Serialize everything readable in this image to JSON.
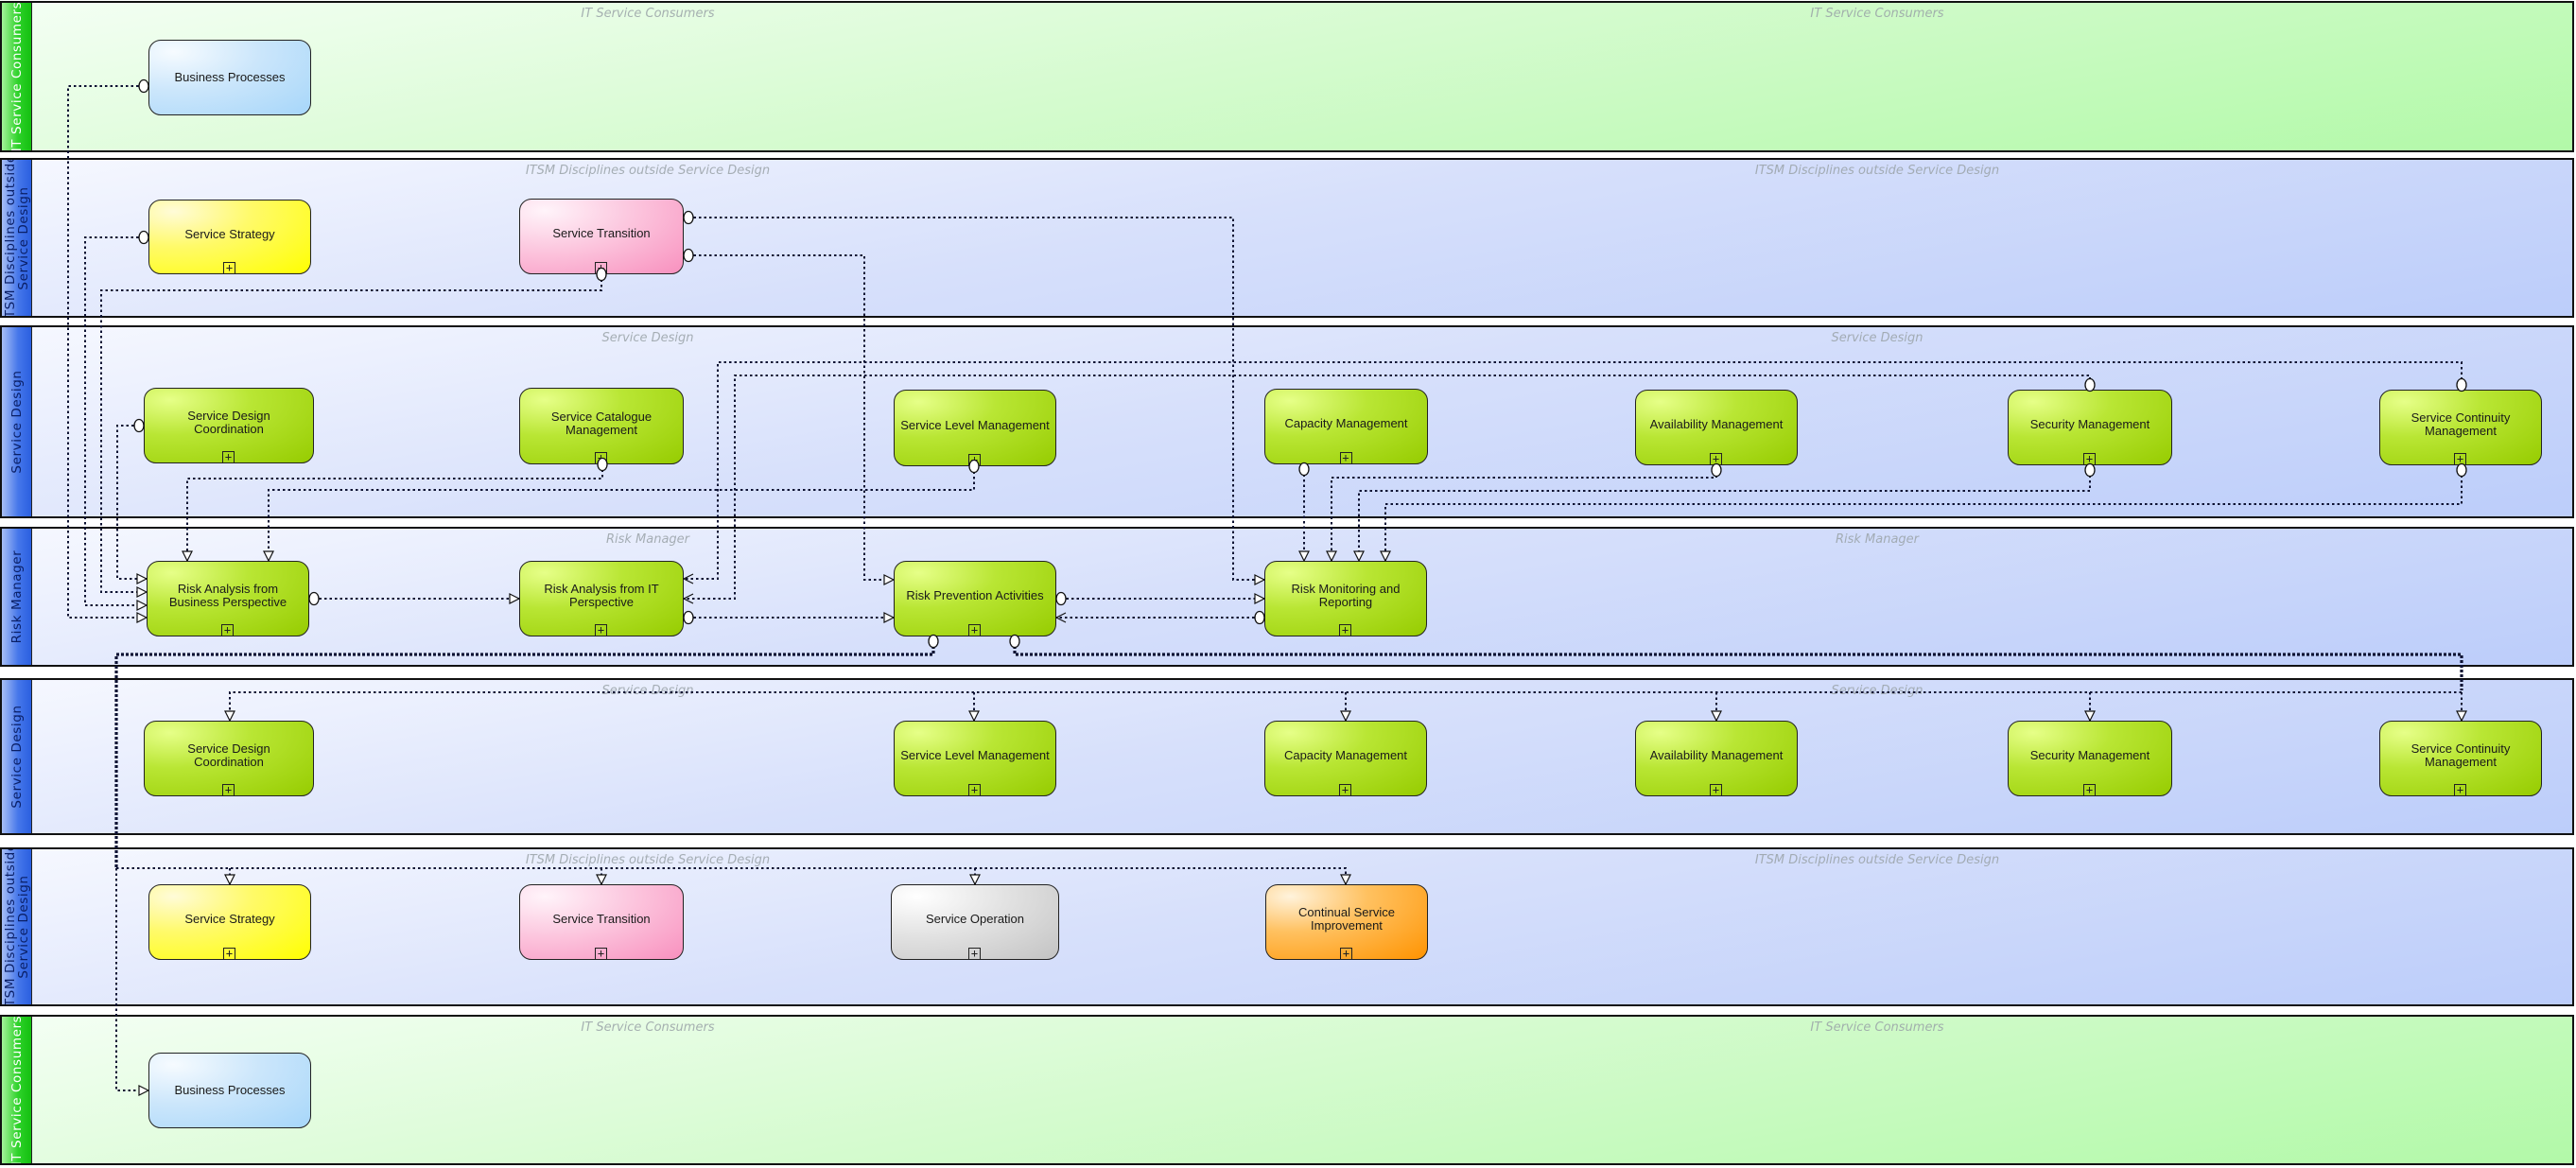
{
  "diagram": {
    "type": "BPMN swimlane process diagram",
    "lanes": [
      {
        "id": "l1",
        "title": "IT Service Consumers",
        "watermark": "IT Service Consumers",
        "style": "green"
      },
      {
        "id": "l2",
        "title": "ITSM Disciplines outside\nService Design",
        "watermark": "ITSM Disciplines outside Service Design",
        "style": "blue"
      },
      {
        "id": "l3",
        "title": "Service Design",
        "watermark": "Service Design",
        "style": "blue"
      },
      {
        "id": "l4",
        "title": "Risk Manager",
        "watermark": "Risk Manager",
        "style": "blue"
      },
      {
        "id": "l5",
        "title": "Service Design",
        "watermark": "Service Design",
        "style": "blue"
      },
      {
        "id": "l6",
        "title": "ITSM Disciplines outside\nService Design",
        "watermark": "ITSM Disciplines outside Service Design",
        "style": "blue"
      },
      {
        "id": "l7",
        "title": "IT Service Consumers",
        "watermark": "IT Service Consumers",
        "style": "green"
      }
    ],
    "nodes": [
      {
        "id": "bp_in",
        "lane": "l1",
        "label": "Business Processes",
        "style": "blue",
        "expandable": false
      },
      {
        "id": "ss_in",
        "lane": "l2",
        "label": "Service Strategy",
        "style": "yellow",
        "expandable": true
      },
      {
        "id": "st_in",
        "lane": "l2",
        "label": "Service Transition",
        "style": "pink",
        "expandable": true
      },
      {
        "id": "sdc_in",
        "lane": "l3",
        "label": "Service Design\nCoordination",
        "style": "green",
        "expandable": true
      },
      {
        "id": "scat_in",
        "lane": "l3",
        "label": "Service Catalogue\nManagement",
        "style": "green",
        "expandable": true
      },
      {
        "id": "slm_in",
        "lane": "l3",
        "label": "Service Level Management",
        "style": "green",
        "expandable": true
      },
      {
        "id": "cap_in",
        "lane": "l3",
        "label": "Capacity Management",
        "style": "green",
        "expandable": true
      },
      {
        "id": "av_in",
        "lane": "l3",
        "label": "Availability Management",
        "style": "green",
        "expandable": true
      },
      {
        "id": "sec_in",
        "lane": "l3",
        "label": "Security Management",
        "style": "green",
        "expandable": true
      },
      {
        "id": "scm_in",
        "lane": "l3",
        "label": "Service Continuity\nManagement",
        "style": "green",
        "expandable": true
      },
      {
        "id": "rabp",
        "lane": "l4",
        "label": "Risk Analysis from\nBusiness Perspective",
        "style": "green",
        "expandable": true
      },
      {
        "id": "rait",
        "lane": "l4",
        "label": "Risk Analysis from IT\nPerspective",
        "style": "green",
        "expandable": true
      },
      {
        "id": "rpa",
        "lane": "l4",
        "label": "Risk Prevention Activities",
        "style": "green",
        "expandable": true
      },
      {
        "id": "rmr",
        "lane": "l4",
        "label": "Risk Monitoring and\nReporting",
        "style": "green",
        "expandable": true
      },
      {
        "id": "sdc_out",
        "lane": "l5",
        "label": "Service Design\nCoordination",
        "style": "green",
        "expandable": true
      },
      {
        "id": "slm_out",
        "lane": "l5",
        "label": "Service Level Management",
        "style": "green",
        "expandable": true
      },
      {
        "id": "cap_out",
        "lane": "l5",
        "label": "Capacity Management",
        "style": "green",
        "expandable": true
      },
      {
        "id": "av_out",
        "lane": "l5",
        "label": "Availability Management",
        "style": "green",
        "expandable": true
      },
      {
        "id": "sec_out",
        "lane": "l5",
        "label": "Security Management",
        "style": "green",
        "expandable": true
      },
      {
        "id": "scm_out",
        "lane": "l5",
        "label": "Service Continuity\nManagement",
        "style": "green",
        "expandable": true
      },
      {
        "id": "ss_out",
        "lane": "l6",
        "label": "Service Strategy",
        "style": "yellow",
        "expandable": true
      },
      {
        "id": "st_out",
        "lane": "l6",
        "label": "Service Transition",
        "style": "pink",
        "expandable": true
      },
      {
        "id": "so_out",
        "lane": "l6",
        "label": "Service Operation",
        "style": "grey",
        "expandable": true
      },
      {
        "id": "csi_out",
        "lane": "l6",
        "label": "Continual Service\nImprovement",
        "style": "orange",
        "expandable": true
      },
      {
        "id": "bp_out",
        "lane": "l7",
        "label": "Business Processes",
        "style": "blue",
        "expandable": false
      }
    ],
    "flows": [
      {
        "from": "bp_in",
        "to": "rabp"
      },
      {
        "from": "ss_in",
        "to": "rabp"
      },
      {
        "from": "st_in",
        "to": "rabp"
      },
      {
        "from": "sdc_in",
        "to": "rabp"
      },
      {
        "from": "scat_in",
        "to": "rabp"
      },
      {
        "from": "slm_in",
        "to": "rabp"
      },
      {
        "from": "scm_in",
        "to": "rait"
      },
      {
        "from": "sec_in",
        "to": "rait"
      },
      {
        "from": "rabp",
        "to": "rait"
      },
      {
        "from": "rait",
        "to": "rpa"
      },
      {
        "from": "st_in",
        "to": "rpa"
      },
      {
        "from": "st_in",
        "to": "rmr"
      },
      {
        "from": "rpa",
        "to": "rmr"
      },
      {
        "from": "rmr",
        "to": "rpa"
      },
      {
        "from": "cap_in",
        "to": "rmr"
      },
      {
        "from": "av_in",
        "to": "rmr"
      },
      {
        "from": "sec_in",
        "to": "rmr"
      },
      {
        "from": "scm_in",
        "to": "rmr"
      },
      {
        "from": "rpa",
        "to": "sdc_out"
      },
      {
        "from": "rpa",
        "to": "slm_out"
      },
      {
        "from": "rpa",
        "to": "cap_out"
      },
      {
        "from": "rpa",
        "to": "av_out"
      },
      {
        "from": "rpa",
        "to": "sec_out"
      },
      {
        "from": "rpa",
        "to": "scm_out"
      },
      {
        "from": "rpa",
        "to": "ss_out"
      },
      {
        "from": "rpa",
        "to": "st_out"
      },
      {
        "from": "rpa",
        "to": "so_out"
      },
      {
        "from": "rpa",
        "to": "csi_out"
      },
      {
        "from": "rpa",
        "to": "bp_out"
      }
    ],
    "expand_marker": "+"
  }
}
